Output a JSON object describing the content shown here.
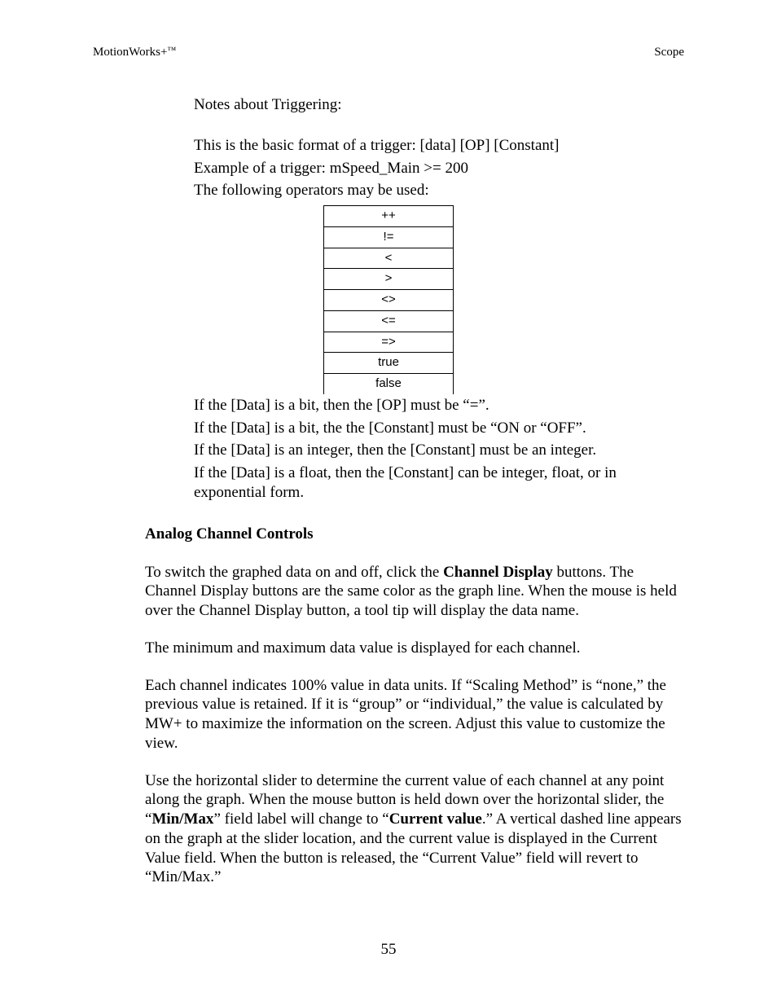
{
  "header": {
    "left_prefix": "MotionWorks+",
    "left_tm": "™",
    "right": "Scope"
  },
  "notes": {
    "title": "Notes about Triggering:",
    "line1": "This is the basic format of a trigger: [data] [OP] [Constant]",
    "line2": "Example of a trigger: mSpeed_Main >= 200",
    "line3": "The following operators may be used:",
    "operators": [
      "++",
      "!=",
      "<",
      ">",
      "<>",
      "<=",
      "=>",
      "true",
      "false"
    ],
    "rule1": "If the [Data] is a bit, then the [OP] must be “=”.",
    "rule2": "If the [Data] is a bit, the the [Constant] must be “ON or “OFF”.",
    "rule3": "If the [Data] is an integer, then the [Constant] must be an integer.",
    "rule4": "If the [Data] is a float, then the [Constant] can be integer, float, or in exponential form."
  },
  "section": {
    "heading": "Analog Channel Controls",
    "p1_a": "To switch the graphed data on and off, click the ",
    "p1_b": "Channel Display",
    "p1_c": " buttons.  The Channel Display buttons are the same color as the graph line.  When the mouse is held over the Channel Display button, a tool tip will display the data name.",
    "p2": "The minimum and maximum data value is displayed for each channel.",
    "p3": "Each channel indicates 100% value in data units. If “Scaling Method” is “none,” the previous value is retained.  If it is “group” or “individual,” the value is calculated by MW+ to maximize the information on the screen. Adjust this value to customize the view.",
    "p4_a": "Use the horizontal slider to determine the current value of each channel at any point along the graph. When the mouse button is held down over the horizontal slider, the “",
    "p4_b": "Min/Max",
    "p4_c": "” field label will change to “",
    "p4_d": "Current value",
    "p4_e": ".”  A vertical dashed line appears on the graph at the slider location, and the current value is displayed in the Current Value field.  When the button is released, the “Current Value” field will revert to “Min/Max.”"
  },
  "page_number": "55"
}
